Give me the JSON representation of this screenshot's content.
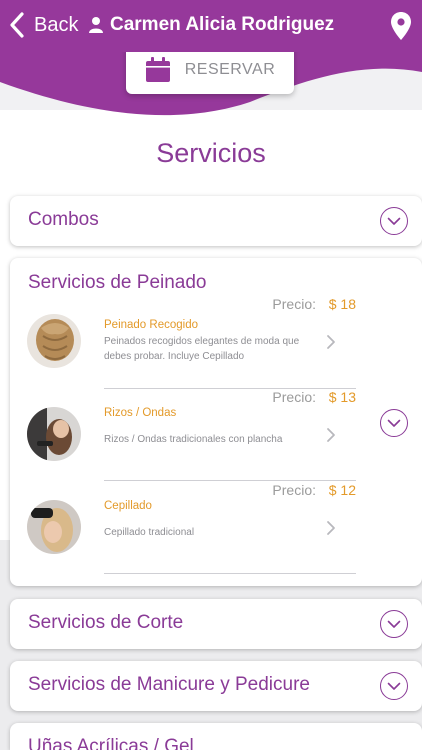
{
  "header": {
    "back_label": "Back",
    "user_name": "Carmen Alicia Rodriguez"
  },
  "reservar": {
    "label": "RESERVAR"
  },
  "page": {
    "title": "Servicios"
  },
  "categories": {
    "combos": "Combos",
    "peinado": "Servicios de Peinado",
    "corte": "Servicios de Corte",
    "manicure": "Servicios de Manicure y Pedicure",
    "unas": "Uñas Acrílicas / Gel"
  },
  "services": [
    {
      "name": "Peinado Recogido",
      "description": "Peinados recogidos elegantes de moda que debes probar. Incluye Cepillado",
      "price_label": "Precio:",
      "price": "$ 18"
    },
    {
      "name": "Rizos / Ondas",
      "description": "Rizos / Ondas tradicionales con plancha",
      "price_label": "Precio:",
      "price": "$ 13"
    },
    {
      "name": "Cepillado",
      "description": "Cepillado tradicional",
      "price_label": "Precio:",
      "price": "$ 12"
    }
  ],
  "colors": {
    "brand_purple": "#96389b",
    "title_purple": "#8a3b97",
    "price_orange": "#e39a2a"
  }
}
